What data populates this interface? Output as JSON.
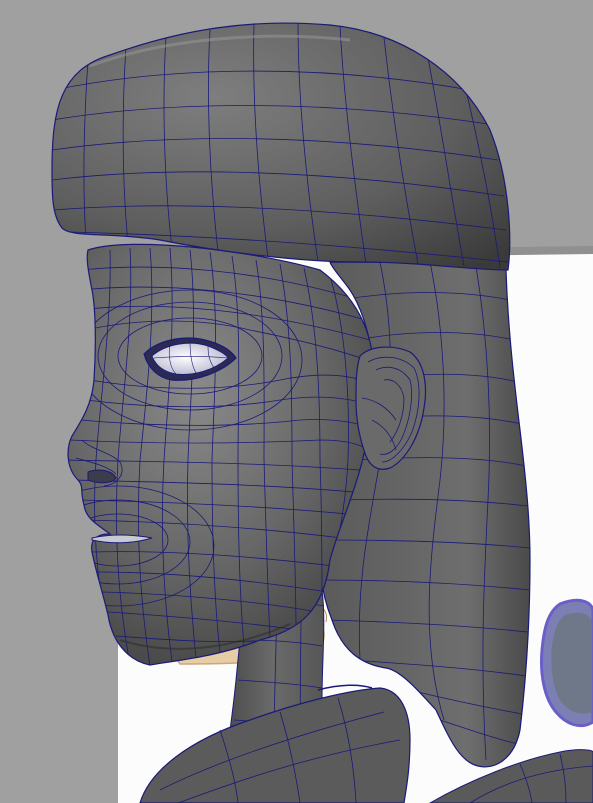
{
  "viewport": {
    "colors": {
      "background": "#a0a0a0",
      "image_plane": "#fcfcfc",
      "mesh_fill": "#656565",
      "mesh_shadow": "#3e3e3e",
      "mesh_highlight": "#8e8e8e",
      "wireframe": "#1a1a78",
      "eye_white": "#eef0ff",
      "reference_sketch": "#e6c9a0",
      "reference_blue": "#8a86d6"
    },
    "scene_objects": [
      "head-mesh",
      "hair-mesh",
      "neck-mesh",
      "shoulder-mesh",
      "eye-mesh",
      "ear-mesh",
      "reference-image-plane"
    ]
  }
}
